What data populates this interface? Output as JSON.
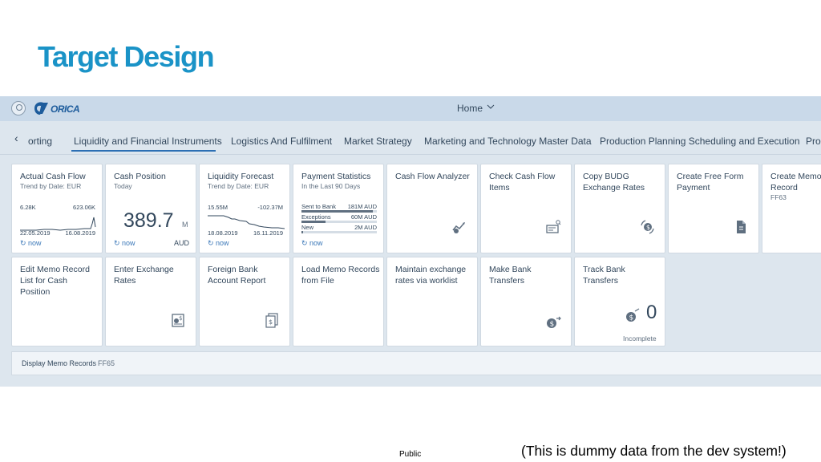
{
  "slide": {
    "title": "Target Design",
    "footer_label": "Public",
    "note": "(This is dummy data from the dev system!)"
  },
  "shell": {
    "logo_text": "ORICA",
    "home_label": "Home"
  },
  "tabs": [
    {
      "label": "orting"
    },
    {
      "label": "Liquidity and Financial Instruments",
      "active": true
    },
    {
      "label": "Logistics And Fulfilment"
    },
    {
      "label": "Market Strategy"
    },
    {
      "label": "Marketing and Technology Master Data"
    },
    {
      "label": "Production Planning Scheduling and Execution"
    },
    {
      "label": "Pro"
    }
  ],
  "tiles_row1": [
    {
      "title": "Actual Cash Flow",
      "subtitle": "Trend by Date: EUR",
      "left_value": "6.28K",
      "right_value": "623.06K",
      "left_date": "22.05.2019",
      "right_date": "16.08.2019",
      "refresh": "now",
      "icon": "refresh-icon"
    },
    {
      "title": "Cash Position",
      "subtitle": "Today",
      "value": "389.7",
      "unit": "M",
      "refresh": "now",
      "currency": "AUD"
    },
    {
      "title": "Liquidity Forecast",
      "subtitle": "Trend by Date: EUR",
      "left_value": "15.55M",
      "right_value": "-102.37M",
      "left_date": "18.08.2019",
      "right_date": "16.11.2019",
      "refresh": "now"
    },
    {
      "title": "Payment Statistics",
      "subtitle": "In the Last 90 Days",
      "rows": [
        {
          "label": "Sent to Bank",
          "value": "181M AUD",
          "fraction": 0.95
        },
        {
          "label": "Exceptions",
          "value": "60M AUD",
          "fraction": 0.32
        },
        {
          "label": "New",
          "value": "2M AUD",
          "fraction": 0.02
        }
      ],
      "refresh": "now"
    },
    {
      "title": "Cash Flow Analyzer",
      "icon": "cash-flow-analyzer-icon"
    },
    {
      "title": "Check Cash Flow Items",
      "icon": "check-cash-flow-icon"
    },
    {
      "title": "Copy BUDG Exchange Rates",
      "icon": "exchange-rates-icon"
    },
    {
      "title": "Create Free Form Payment",
      "icon": "document-icon"
    },
    {
      "title": "Create Memo Record",
      "subtitle": "FF63"
    }
  ],
  "tiles_row2": [
    {
      "title": "Edit Memo Record List for Cash Position"
    },
    {
      "title": "Enter Exchange Rates",
      "icon": "exchange-document-icon"
    },
    {
      "title": "Foreign Bank Account Report",
      "icon": "bank-report-icon"
    },
    {
      "title": "Load Memo Records from File"
    },
    {
      "title": "Maintain exchange rates via worklist"
    },
    {
      "title": "Make Bank Transfers",
      "icon": "money-transfer-icon"
    },
    {
      "title": "Track Bank Transfers",
      "count": "0",
      "status": "Incomplete",
      "icon": "money-transfer-icon"
    }
  ],
  "link_tile": {
    "title": "Display Memo Records",
    "subtitle": "FF65"
  },
  "colors": {
    "title_blue": "#1a93c7",
    "shell_bg": "#c9d9e9",
    "page_bg": "#dde6ee",
    "link_blue": "#3a77b8"
  }
}
